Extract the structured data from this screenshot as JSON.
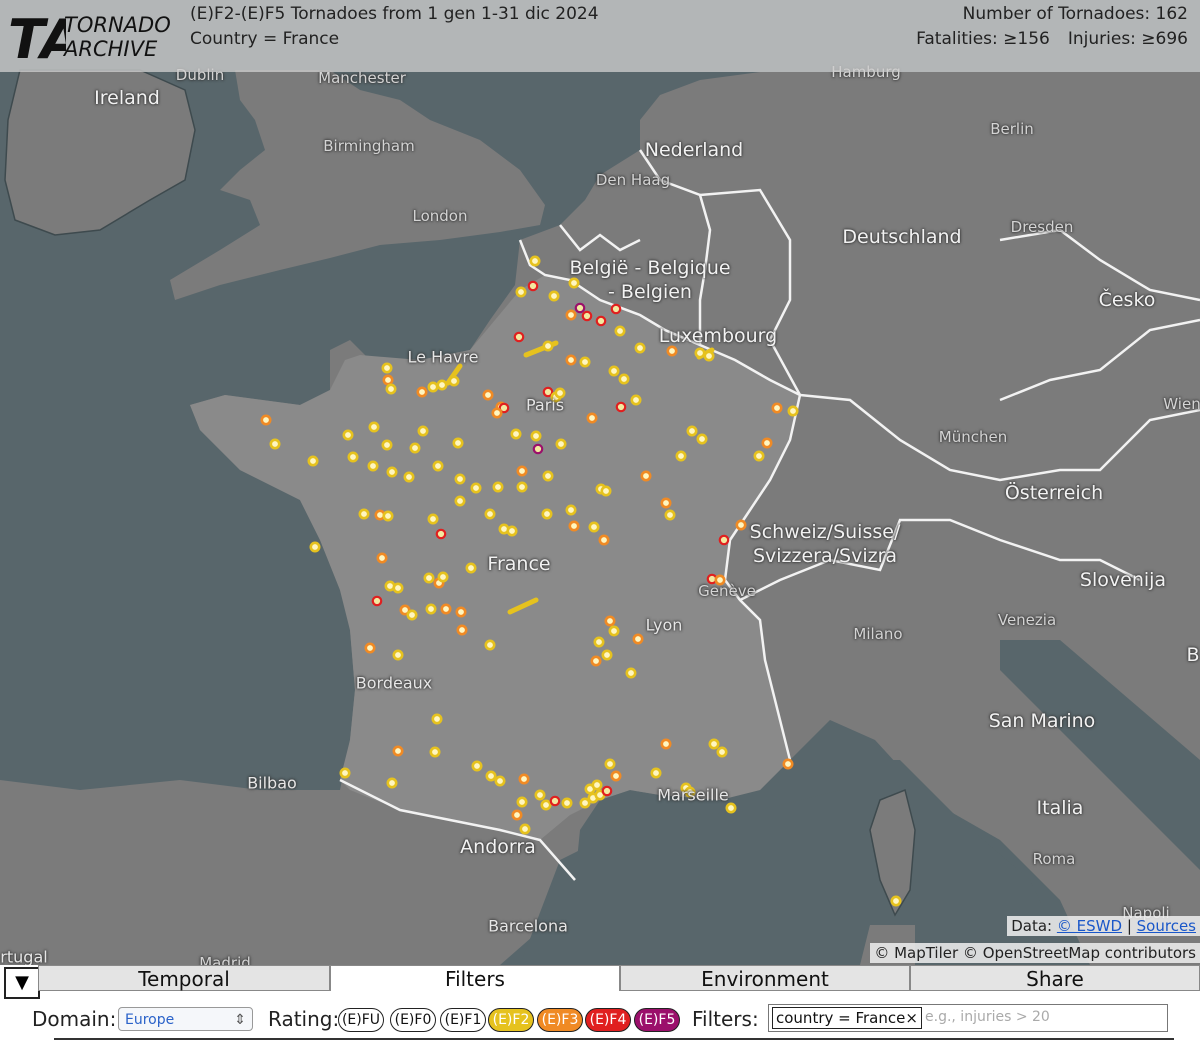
{
  "header": {
    "logo_text": "TA TORNADO ARCHIVE",
    "logo_ta": "TA",
    "logo_line1": "TORNADO",
    "logo_line2": "ARCHIVE",
    "title": "(E)F2-(E)F5 Tornadoes from 1 gen 1-31 dic 2024",
    "subtitle": "Country = France",
    "count": "Number of Tornadoes: 162",
    "fatalities": "Fatalities: ≥156",
    "injuries": "Injuries: ≥696"
  },
  "map": {
    "labels": {
      "dublin": "Dublin",
      "manchester": "Manchester",
      "ireland": "Ireland",
      "birmingham": "Birmingham",
      "london": "London",
      "hamburg": "Hamburg",
      "berlin": "Berlin",
      "nederland": "Nederland",
      "den_haag": "Den Haag",
      "deutschland": "Deutschland",
      "dresden": "Dresden",
      "belgie1": "België - Belgique",
      "belgie2": "- Belgien",
      "luxembourg": "Luxembourg",
      "cesko": "Česko",
      "le_havre": "Le Havre",
      "paris": "Paris",
      "wien": "Wien",
      "munchen": "München",
      "osterreich": "Österreich",
      "schweiz1": "Schweiz/Suisse/",
      "schweiz2": "Svizzera/Svizra",
      "france": "France",
      "geneve": "Genève",
      "slovenija": "Slovenija",
      "lyon": "Lyon",
      "milano": "Milano",
      "venezia": "Venezia",
      "bordeaux": "Bordeaux",
      "san_marino": "San Marino",
      "bilbao": "Bilbao",
      "marseille": "Marseille",
      "andorra": "Andorra",
      "italia": "Italia",
      "roma": "Roma",
      "barcelona": "Barcelona",
      "napoli": "Napoli",
      "portugal": "rtugal",
      "madrid": "Madrid",
      "b_edge": "B"
    },
    "rating_colors": {
      "F2": "#e6c21e",
      "F3": "#f08a24",
      "F4": "#e01f1f",
      "F5": "#9b0f6b"
    },
    "tornadoes": [
      [
        535,
        261,
        "F2"
      ],
      [
        533,
        286,
        "F4"
      ],
      [
        521,
        292,
        "F2"
      ],
      [
        554,
        296,
        "F2"
      ],
      [
        574,
        283,
        "F2"
      ],
      [
        580,
        308,
        "F5"
      ],
      [
        571,
        315,
        "F3"
      ],
      [
        587,
        316,
        "F4"
      ],
      [
        601,
        321,
        "F4"
      ],
      [
        616,
        309,
        "F4"
      ],
      [
        620,
        331,
        "F2"
      ],
      [
        519,
        337,
        "F4"
      ],
      [
        548,
        346,
        "F2"
      ],
      [
        571,
        360,
        "F3"
      ],
      [
        585,
        362,
        "F2"
      ],
      [
        640,
        348,
        "F2"
      ],
      [
        614,
        371,
        "F2"
      ],
      [
        624,
        379,
        "F2"
      ],
      [
        548,
        392,
        "F4"
      ],
      [
        556,
        397,
        "F2"
      ],
      [
        560,
        393,
        "F2"
      ],
      [
        501,
        407,
        "F3"
      ],
      [
        504,
        408,
        "F4"
      ],
      [
        488,
        395,
        "F3"
      ],
      [
        497,
        413,
        "F3"
      ],
      [
        592,
        418,
        "F3"
      ],
      [
        621,
        407,
        "F4"
      ],
      [
        636,
        400,
        "F2"
      ],
      [
        538,
        449,
        "F5"
      ],
      [
        516,
        434,
        "F2"
      ],
      [
        536,
        436,
        "F2"
      ],
      [
        561,
        444,
        "F2"
      ],
      [
        522,
        471,
        "F3"
      ],
      [
        548,
        476,
        "F2"
      ],
      [
        522,
        487,
        "F2"
      ],
      [
        601,
        489,
        "F2"
      ],
      [
        606,
        491,
        "F2"
      ],
      [
        646,
        476,
        "F3"
      ],
      [
        681,
        456,
        "F2"
      ],
      [
        692,
        431,
        "F2"
      ],
      [
        702,
        439,
        "F2"
      ],
      [
        759,
        456,
        "F2"
      ],
      [
        767,
        443,
        "F3"
      ],
      [
        777,
        408,
        "F3"
      ],
      [
        793,
        411,
        "F2"
      ],
      [
        672,
        351,
        "F3"
      ],
      [
        700,
        353,
        "F2"
      ],
      [
        709,
        356,
        "F2"
      ],
      [
        387,
        368,
        "F2"
      ],
      [
        388,
        380,
        "F3"
      ],
      [
        391,
        389,
        "F2"
      ],
      [
        422,
        392,
        "F3"
      ],
      [
        433,
        387,
        "F2"
      ],
      [
        442,
        385,
        "F2"
      ],
      [
        454,
        381,
        "F2"
      ],
      [
        266,
        420,
        "F3"
      ],
      [
        275,
        444,
        "F2"
      ],
      [
        313,
        461,
        "F2"
      ],
      [
        348,
        435,
        "F2"
      ],
      [
        353,
        457,
        "F2"
      ],
      [
        374,
        427,
        "F2"
      ],
      [
        373,
        466,
        "F2"
      ],
      [
        387,
        445,
        "F2"
      ],
      [
        392,
        472,
        "F2"
      ],
      [
        409,
        477,
        "F2"
      ],
      [
        415,
        448,
        "F2"
      ],
      [
        423,
        431,
        "F2"
      ],
      [
        438,
        466,
        "F2"
      ],
      [
        458,
        443,
        "F2"
      ],
      [
        460,
        479,
        "F2"
      ],
      [
        476,
        488,
        "F2"
      ],
      [
        498,
        487,
        "F2"
      ],
      [
        364,
        514,
        "F2"
      ],
      [
        380,
        515,
        "F3"
      ],
      [
        388,
        516,
        "F2"
      ],
      [
        433,
        519,
        "F2"
      ],
      [
        441,
        534,
        "F4"
      ],
      [
        460,
        501,
        "F2"
      ],
      [
        490,
        514,
        "F2"
      ],
      [
        504,
        529,
        "F2"
      ],
      [
        512,
        531,
        "F2"
      ],
      [
        547,
        514,
        "F2"
      ],
      [
        571,
        510,
        "F2"
      ],
      [
        574,
        526,
        "F3"
      ],
      [
        594,
        527,
        "F2"
      ],
      [
        604,
        540,
        "F3"
      ],
      [
        666,
        503,
        "F3"
      ],
      [
        670,
        515,
        "F2"
      ],
      [
        741,
        525,
        "F3"
      ],
      [
        724,
        540,
        "F4"
      ],
      [
        712,
        579,
        "F4"
      ],
      [
        720,
        580,
        "F3"
      ],
      [
        315,
        547,
        "F2"
      ],
      [
        382,
        558,
        "F3"
      ],
      [
        377,
        601,
        "F4"
      ],
      [
        390,
        586,
        "F2"
      ],
      [
        398,
        588,
        "F2"
      ],
      [
        405,
        610,
        "F3"
      ],
      [
        412,
        615,
        "F2"
      ],
      [
        429,
        578,
        "F2"
      ],
      [
        439,
        583,
        "F3"
      ],
      [
        443,
        577,
        "F2"
      ],
      [
        431,
        609,
        "F2"
      ],
      [
        446,
        609,
        "F3"
      ],
      [
        461,
        612,
        "F3"
      ],
      [
        462,
        630,
        "F3"
      ],
      [
        471,
        568,
        "F2"
      ],
      [
        490,
        645,
        "F2"
      ],
      [
        610,
        621,
        "F3"
      ],
      [
        614,
        631,
        "F2"
      ],
      [
        599,
        642,
        "F2"
      ],
      [
        607,
        655,
        "F2"
      ],
      [
        596,
        661,
        "F3"
      ],
      [
        638,
        639,
        "F3"
      ],
      [
        631,
        673,
        "F2"
      ],
      [
        370,
        648,
        "F3"
      ],
      [
        398,
        655,
        "F2"
      ],
      [
        437,
        719,
        "F2"
      ],
      [
        398,
        751,
        "F3"
      ],
      [
        435,
        752,
        "F2"
      ],
      [
        345,
        773,
        "F2"
      ],
      [
        392,
        783,
        "F2"
      ],
      [
        477,
        766,
        "F2"
      ],
      [
        491,
        776,
        "F2"
      ],
      [
        500,
        781,
        "F2"
      ],
      [
        524,
        779,
        "F3"
      ],
      [
        540,
        795,
        "F2"
      ],
      [
        546,
        805,
        "F2"
      ],
      [
        555,
        801,
        "F4"
      ],
      [
        567,
        803,
        "F2"
      ],
      [
        585,
        803,
        "F2"
      ],
      [
        522,
        802,
        "F2"
      ],
      [
        517,
        815,
        "F3"
      ],
      [
        525,
        829,
        "F2"
      ],
      [
        590,
        789,
        "F2"
      ],
      [
        597,
        785,
        "F2"
      ],
      [
        593,
        798,
        "F2"
      ],
      [
        600,
        795,
        "F2"
      ],
      [
        607,
        791,
        "F4"
      ],
      [
        610,
        764,
        "F2"
      ],
      [
        616,
        776,
        "F3"
      ],
      [
        656,
        773,
        "F2"
      ],
      [
        666,
        744,
        "F3"
      ],
      [
        714,
        744,
        "F2"
      ],
      [
        722,
        752,
        "F2"
      ],
      [
        686,
        788,
        "F2"
      ],
      [
        690,
        792,
        "F2"
      ],
      [
        731,
        808,
        "F2"
      ],
      [
        788,
        764,
        "F3"
      ],
      [
        896,
        901,
        "F2"
      ]
    ],
    "tracks": [
      [
        [
          526,
          355
        ],
        [
          556,
          343
        ]
      ],
      [
        [
          448,
          383
        ],
        [
          460,
          366
        ]
      ],
      [
        [
          510,
          612
        ],
        [
          536,
          600
        ]
      ],
      [
        [
          699,
          357
        ],
        [
          712,
          350
        ]
      ]
    ],
    "attribution_data": "Data:",
    "attribution_eswd": "© ESWD",
    "attribution_sep": "|",
    "attribution_sources": "Sources",
    "attribution_tiles": "© MapTiler © OpenStreetMap contributors"
  },
  "panel": {
    "toggle_icon": "▼",
    "tabs": [
      "Temporal",
      "Filters",
      "Environment",
      "Share"
    ],
    "active_tab": "Filters",
    "domain_label": "Domain:",
    "domain_value": "Europe",
    "rating_label": "Rating:",
    "ratings": [
      {
        "label": "(E)FU",
        "active": false,
        "color": "#ffffff"
      },
      {
        "label": "(E)F0",
        "active": false,
        "color": "#ffffff"
      },
      {
        "label": "(E)F1",
        "active": false,
        "color": "#ffffff"
      },
      {
        "label": "(E)F2",
        "active": true,
        "color": "#e6c21e"
      },
      {
        "label": "(E)F3",
        "active": true,
        "color": "#f08a24"
      },
      {
        "label": "(E)F4",
        "active": true,
        "color": "#e01f1f"
      },
      {
        "label": "(E)F5",
        "active": true,
        "color": "#9b0f6b"
      }
    ],
    "filters_label": "Filters:",
    "filter_chip": "country = France",
    "filter_chip_close": "×",
    "filter_placeholder": "e.g., injuries > 20"
  }
}
